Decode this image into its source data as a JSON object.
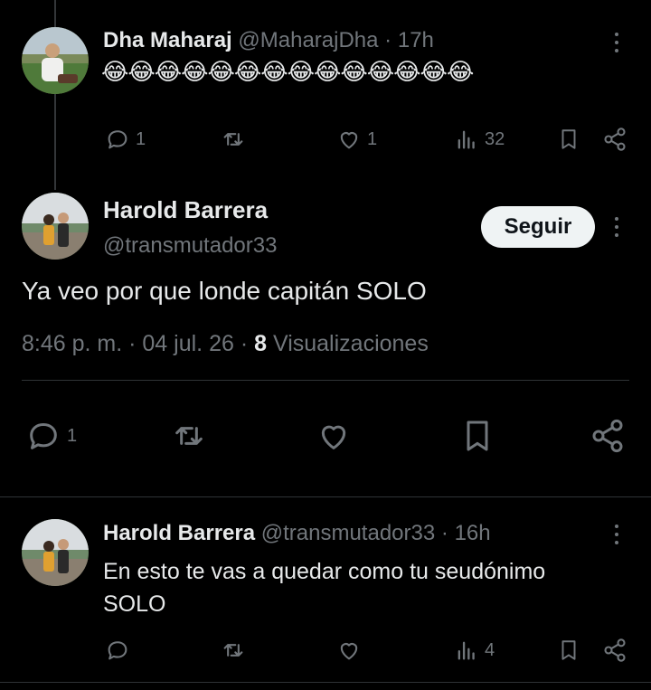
{
  "tweet1": {
    "display_name": "Dha Maharaj",
    "handle": "@MaharajDha",
    "separator": "·",
    "time": "17h",
    "content": "😂😂😂😂😂😂😂😂😂😂😂😂😂😂",
    "replies": "1",
    "likes": "1",
    "views": "32"
  },
  "main_tweet": {
    "display_name": "Harold Barrera",
    "handle": "@transmutador33",
    "follow_label": "Seguir",
    "content": "Ya veo por que londe capitán SOLO",
    "time": "8:46 p. m.",
    "date": "04 jul. 26",
    "separator": "·",
    "views_count": "8",
    "views_label": "Visualizaciones",
    "replies": "1"
  },
  "reply": {
    "display_name": "Harold Barrera",
    "handle": "@transmutador33",
    "separator": "·",
    "time": "16h",
    "content_line1": "En esto te vas a quedar como tu seudónimo",
    "content_line2": "SOLO",
    "views": "4"
  },
  "colors": {
    "background": "#000000",
    "text": "#e7e9ea",
    "muted": "#71767b",
    "divider": "#2f3336",
    "follow_bg": "#eff3f4"
  }
}
